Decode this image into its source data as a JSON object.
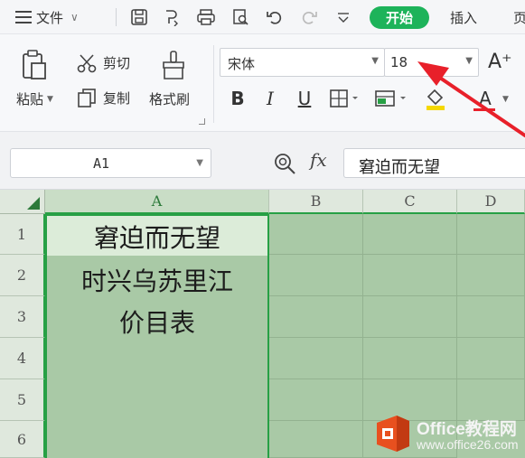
{
  "menubar": {
    "file_label": "文件",
    "tab_start": "开始",
    "tab_insert": "插入",
    "tab_next": "页"
  },
  "ribbon": {
    "cut_label": "剪切",
    "copy_label": "复制",
    "paste_label": "粘贴",
    "format_painter_label": "格式刷",
    "font_name": "宋体",
    "font_size": "18",
    "bold_glyph": "B",
    "italic_glyph": "I",
    "underline_glyph": "U",
    "font_color_glyph": "A",
    "grow_font_glyph": "A⁺"
  },
  "formula_bar": {
    "name_box": "A1",
    "fx_label": "fx",
    "formula": "窘迫而无望"
  },
  "sheet": {
    "columns": [
      "A",
      "B",
      "C",
      "D"
    ],
    "rows": [
      "1",
      "2",
      "3",
      "4",
      "5",
      "6"
    ],
    "a1": "窘迫而无望",
    "a2": "时兴乌苏里江",
    "a3": "价目表"
  },
  "watermark": {
    "title": "Office教程网",
    "url": "www.office26.com"
  },
  "colors": {
    "accent_green": "#1db35a",
    "selection_border": "#27a045",
    "sheet_fill": "#a9c9a6",
    "annotation_arrow": "#e8202a"
  },
  "icons": [
    "menu-icon",
    "save-icon",
    "print-icon",
    "undo-icon",
    "redo-icon",
    "paste-icon",
    "scissors-icon",
    "copy-icon",
    "brush-icon",
    "border-icon",
    "fill-color-icon",
    "zoom-icon",
    "office-logo-icon"
  ]
}
